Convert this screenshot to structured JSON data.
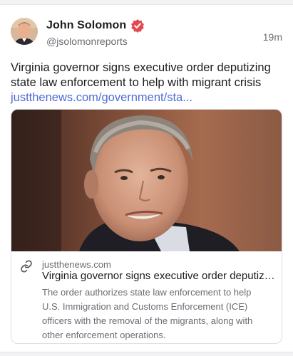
{
  "post": {
    "author": {
      "display_name": "John Solomon",
      "handle": "@jsolomonreports",
      "verified": true,
      "avatar_icon": "avatar-photo"
    },
    "timestamp": "19m",
    "text_lines": [
      "Virginia governor signs executive order deputizing",
      "state law enforcement to help with migrant crisis"
    ],
    "link_text": "justthenews.com/government/sta...",
    "accent_color": "#4f6bd8",
    "verified_color": "#e5484d"
  },
  "card": {
    "image_icon": "article-photo",
    "link_icon": "link-icon",
    "domain": "justthenews.com",
    "title": "Virginia governor signs executive order deputizing state law enforcement to help with migrant crisis",
    "description_lines": [
      "The order authorizes state law enforcement to help",
      "U.S. Immigration and Customs Enforcement (ICE)",
      "officers with the removal of the migrants, along with",
      "other enforcement operations."
    ]
  }
}
